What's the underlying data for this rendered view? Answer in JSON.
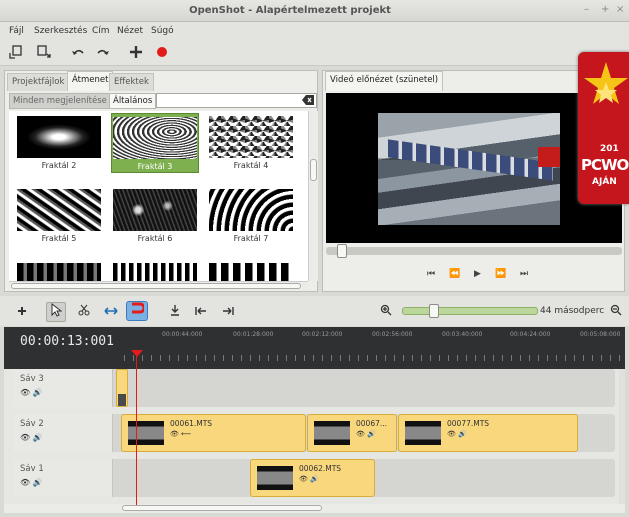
{
  "window": {
    "title": "OpenShot - Alapértelmezett projekt",
    "controls": [
      "–",
      "+",
      "×"
    ]
  },
  "menu": {
    "items": [
      "Fájl",
      "Szerkesztés",
      "Cím",
      "Nézet",
      "Súgó"
    ]
  },
  "toolbar": {
    "icons": [
      "import-files-icon",
      "export-icon",
      "undo-icon",
      "redo-icon",
      "add-track-icon",
      "record-icon"
    ]
  },
  "left_panel": {
    "tabs": [
      "Projektfájlok",
      "Átmenet",
      "Effektek"
    ],
    "active_tab": "Átmenet",
    "filter_all": "Minden megjelenítése",
    "filter_common": "Általános",
    "search_value": "",
    "transitions": [
      {
        "label": "Fraktál 2"
      },
      {
        "label": "Fraktál 3"
      },
      {
        "label": "Fraktál 4"
      },
      {
        "label": "Fraktál 5"
      },
      {
        "label": "Fraktál 6"
      },
      {
        "label": "Fraktál 7"
      }
    ],
    "selected": "Fraktál 3"
  },
  "preview": {
    "tab": "Videó előnézet (szünetel)",
    "controls": [
      "⏮",
      "⏪",
      "▶",
      "⏩",
      "⏭"
    ]
  },
  "badge": {
    "year": "201",
    "brand": "PCWO",
    "tag": "AJÁN"
  },
  "timeline": {
    "zoom_label": "44 másodperc",
    "timecode": "00:00:13:001",
    "ticks": [
      "00:00:44:000",
      "00:01:28:000",
      "00:02:12:000",
      "00:02:56:000",
      "00:03:40:000",
      "00:04:24:000",
      "00:05:08:000"
    ],
    "tracks": [
      {
        "name": "Sáv 3",
        "clips": []
      },
      {
        "name": "Sáv 2",
        "clips": [
          "00061.MTS",
          "00067...",
          "00077.MTS"
        ]
      },
      {
        "name": "Sáv 1",
        "clips": [
          "00062.MTS"
        ]
      }
    ]
  },
  "colors": {
    "accent_green": "#7fb04f",
    "clip_yellow": "#f8d77d",
    "playhead_red": "#e31b1b",
    "record_red": "#e31b1b"
  }
}
